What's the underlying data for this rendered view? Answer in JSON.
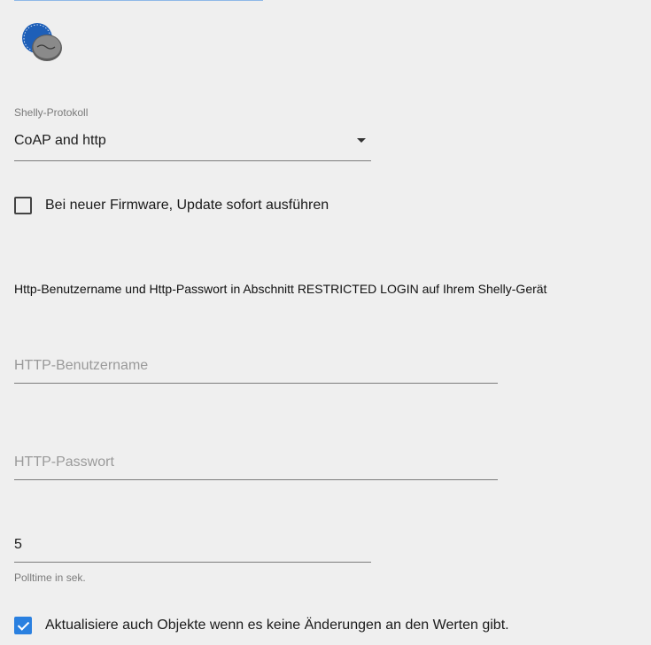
{
  "protocol": {
    "label": "Shelly-Protokoll",
    "value": "CoAP and http"
  },
  "firmware_update": {
    "label": "Bei neuer Firmware, Update sofort ausführen",
    "checked": false
  },
  "login_info": "Http-Benutzername und Http-Passwort in Abschnitt RESTRICTED LOGIN auf Ihrem Shelly-Gerät",
  "http_user": {
    "placeholder": "HTTP-Benutzername",
    "value": ""
  },
  "http_password": {
    "placeholder": "HTTP-Passwort",
    "value": ""
  },
  "polltime": {
    "value": "5",
    "helper": "Polltime in sek."
  },
  "update_objects": {
    "label": "Aktualisiere auch Objekte wenn es keine Änderungen an den Werten gibt.",
    "checked": true
  },
  "colors": {
    "accent": "#2a80e0",
    "logo_blue": "#1e5fb8",
    "logo_gray": "#7d7d7d"
  },
  "icons": {
    "logo": "shelly-adapter-logo",
    "dropdown": "triangle-down-icon"
  }
}
